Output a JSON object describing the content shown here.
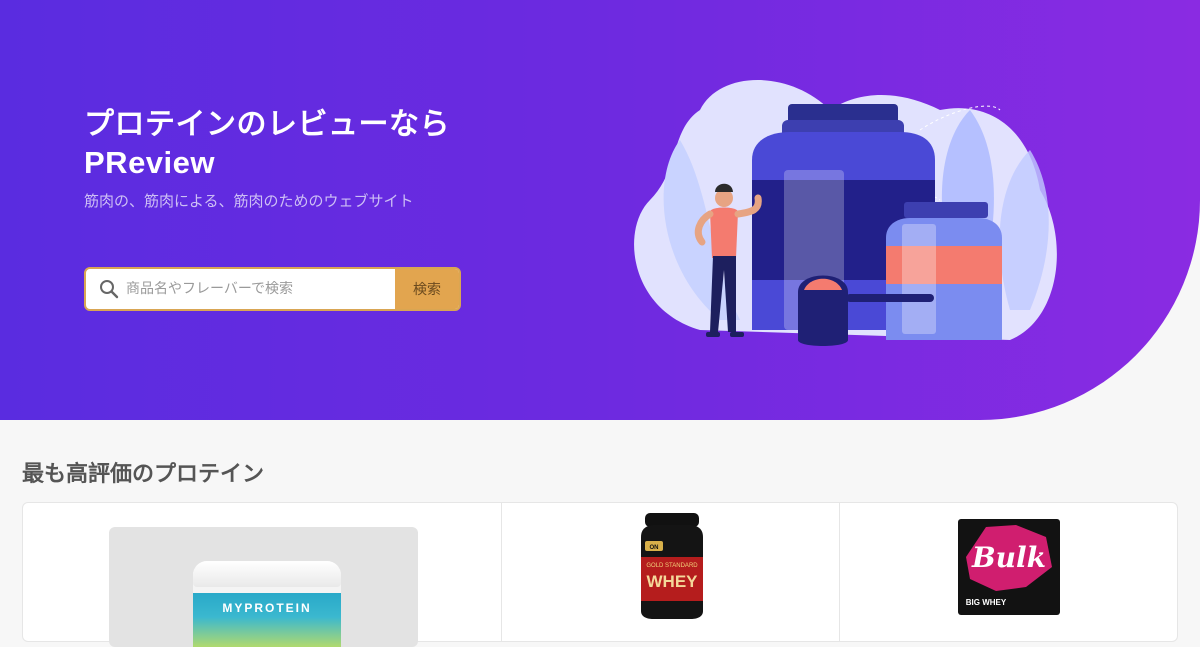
{
  "hero": {
    "title_line1": "プロテインのレビューなら",
    "title_line2": "PReview",
    "subtitle": "筋肉の、筋肉による、筋肉のためのウェブサイト",
    "search": {
      "placeholder": "商品名やフレーバーで検索",
      "button_label": "検索"
    }
  },
  "section": {
    "title": "最も高評価のプロテイン"
  },
  "products": [
    {
      "brand_text": "MYPROTEIN"
    },
    {
      "brand_text": "WHEY",
      "sub_text": "GOLD STANDARD",
      "brand_mark": "ON"
    },
    {
      "brand_text": "Bulk",
      "sub_text": "BIG WHEY"
    }
  ],
  "colors": {
    "hero_start": "#5a2ce0",
    "hero_end": "#8a2be2",
    "search_button": "#e2a54f",
    "page_bg": "#f7f7f7"
  }
}
